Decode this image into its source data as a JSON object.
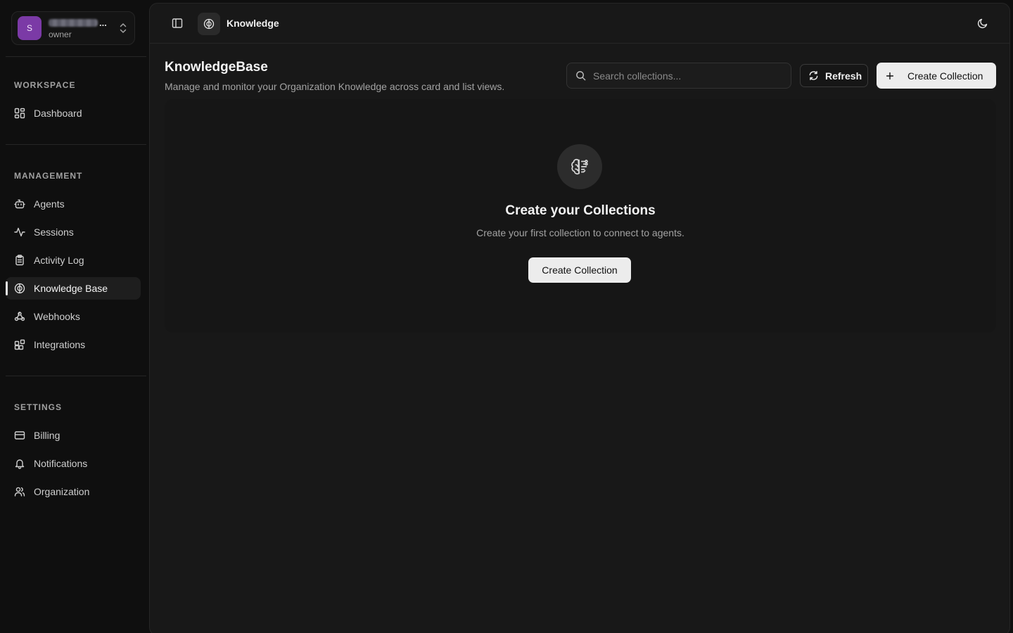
{
  "org": {
    "avatar_letter": "S",
    "name_ellipsis": "...",
    "role": "owner"
  },
  "sidebar": {
    "sections": [
      {
        "title": "WORKSPACE",
        "items": [
          {
            "label": "Dashboard",
            "icon": "dashboard-icon"
          }
        ]
      },
      {
        "title": "MANAGEMENT",
        "items": [
          {
            "label": "Agents",
            "icon": "bot-icon"
          },
          {
            "label": "Sessions",
            "icon": "activity-icon"
          },
          {
            "label": "Activity Log",
            "icon": "clipboard-icon"
          },
          {
            "label": "Knowledge Base",
            "icon": "brain-icon",
            "active": true
          },
          {
            "label": "Webhooks",
            "icon": "webhook-icon"
          },
          {
            "label": "Integrations",
            "icon": "blocks-icon"
          }
        ]
      },
      {
        "title": "SETTINGS",
        "items": [
          {
            "label": "Billing",
            "icon": "credit-card-icon"
          },
          {
            "label": "Notifications",
            "icon": "bell-icon"
          },
          {
            "label": "Organization",
            "icon": "users-icon"
          }
        ]
      }
    ]
  },
  "topbar": {
    "breadcrumb": "Knowledge"
  },
  "page": {
    "title": "KnowledgeBase",
    "subtitle": "Manage and monitor your Organization Knowledge across card and list views.",
    "search_placeholder": "Search collections...",
    "refresh_label": "Refresh",
    "create_label": "Create Collection"
  },
  "empty_state": {
    "title": "Create your Collections",
    "subtitle": "Create your first collection to connect to agents.",
    "button_label": "Create Collection"
  }
}
